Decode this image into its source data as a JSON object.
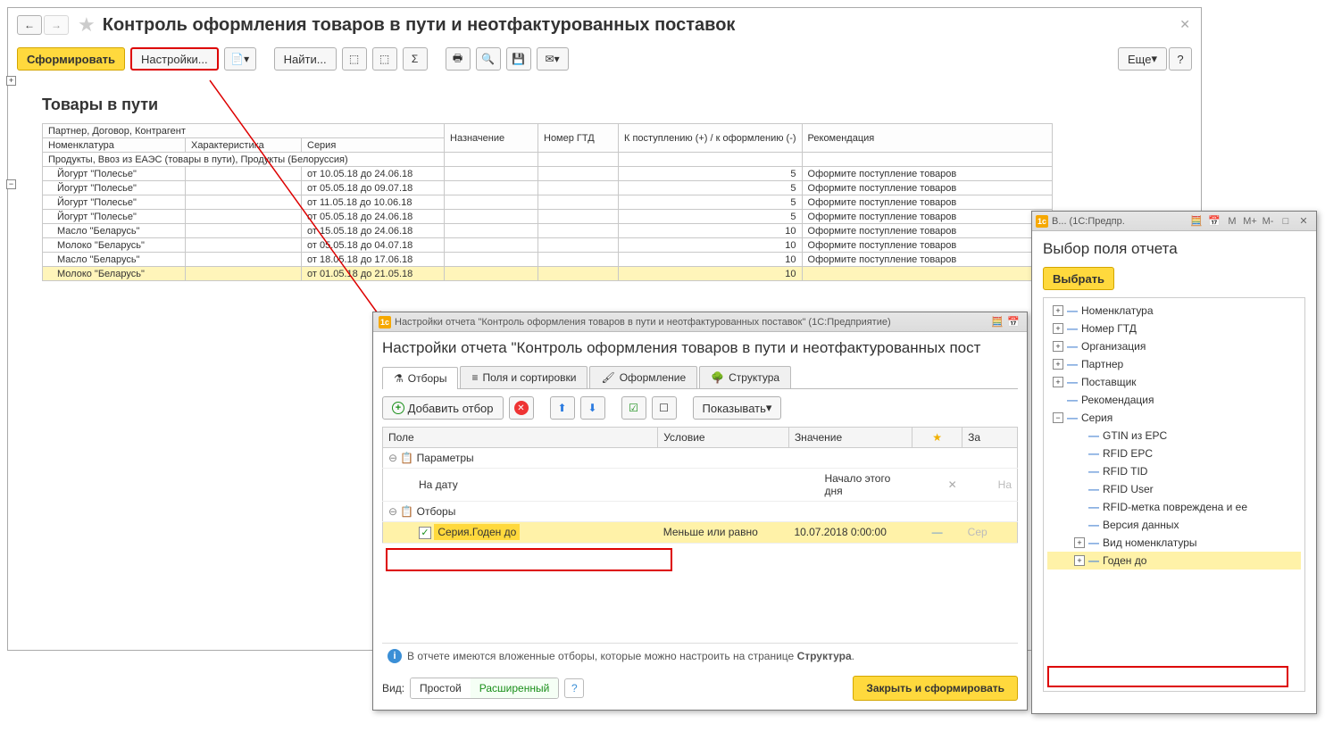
{
  "page_title": "Контроль оформления товаров в пути и неотфактурованных поставок",
  "toolbar": {
    "generate": "Сформировать",
    "settings": "Настройки...",
    "find": "Найти...",
    "more": "Еще",
    "help": "?"
  },
  "report": {
    "title": "Товары в пути",
    "headers": {
      "partner": "Партнер, Договор, Контрагент",
      "nomen": "Номенклатура",
      "char": "Характеристика",
      "series": "Серия",
      "dest": "Назначение",
      "gtd": "Номер ГТД",
      "incoming": "К поступлению (+) / к оформлению (-)",
      "recom": "Рекомендация"
    },
    "group_row": "Продукты, Ввоз из ЕАЭС (товары в пути), Продукты (Белоруссия)",
    "rows": [
      {
        "n": "Йогурт \"Полесье\"",
        "s": "от 10.05.18 до 24.06.18",
        "q": 5,
        "r": "Оформите поступление товаров"
      },
      {
        "n": "Йогурт \"Полесье\"",
        "s": "от 05.05.18 до 09.07.18",
        "q": 5,
        "r": "Оформите поступление товаров"
      },
      {
        "n": "Йогурт \"Полесье\"",
        "s": "от 11.05.18 до 10.06.18",
        "q": 5,
        "r": "Оформите поступление товаров"
      },
      {
        "n": "Йогурт \"Полесье\"",
        "s": "от 05.05.18 до 24.06.18",
        "q": 5,
        "r": "Оформите поступление товаров"
      },
      {
        "n": "Масло \"Беларусь\"",
        "s": "от 15.05.18 до 24.06.18",
        "q": 10,
        "r": "Оформите поступление товаров"
      },
      {
        "n": "Молоко \"Беларусь\"",
        "s": "от 05.05.18 до 04.07.18",
        "q": 10,
        "r": "Оформите поступление товаров"
      },
      {
        "n": "Масло \"Беларусь\"",
        "s": "от 18.05.18 до 17.06.18",
        "q": 10,
        "r": "Оформите поступление товаров"
      },
      {
        "n": "Молоко \"Беларусь\"",
        "s": "от 01.05.18 до 21.05.18",
        "q": 10,
        "r": ""
      }
    ]
  },
  "settings_dlg": {
    "titlebar": "Настройки отчета \"Контроль оформления товаров в пути и неотфактурованных поставок\" (1С:Предприятие)",
    "heading": "Настройки отчета \"Контроль оформления товаров в пути и неотфактурованных пост",
    "tabs": {
      "filters": "Отборы",
      "fields": "Поля и сортировки",
      "design": "Оформление",
      "struct": "Структура"
    },
    "sub": {
      "add": "Добавить отбор",
      "show": "Показывать"
    },
    "th": {
      "field": "Поле",
      "cond": "Условие",
      "value": "Значение",
      "star": "★",
      "title": "За"
    },
    "rows": {
      "params": "Параметры",
      "on_date": "На дату",
      "on_date_val": "Начало этого дня",
      "on_date_title": "На",
      "filters": "Отборы",
      "sel_field": "Серия.Годен до",
      "sel_cond": "Меньше или равно",
      "sel_val": "10.07.2018 0:00:00",
      "sel_title": "Сер"
    },
    "info": "В отчете имеются вложенные отборы, которые можно настроить на странице ",
    "info_b": "Структура",
    "view_label": "Вид:",
    "view_simple": "Простой",
    "view_ext": "Расширенный",
    "close_btn": "Закрыть и сформировать"
  },
  "field_dlg": {
    "titlebar_left": "В... (1С:Предпр.",
    "m": "M",
    "mp": "M+",
    "mm": "M-",
    "heading": "Выбор поля отчета",
    "select": "Выбрать",
    "tree": [
      {
        "lv": 1,
        "exp": "+",
        "label": "Номенклатура"
      },
      {
        "lv": 1,
        "exp": "+",
        "label": "Номер ГТД"
      },
      {
        "lv": 1,
        "exp": "+",
        "label": "Организация"
      },
      {
        "lv": 1,
        "exp": "+",
        "label": "Партнер"
      },
      {
        "lv": 1,
        "exp": "+",
        "label": "Поставщик"
      },
      {
        "lv": 1,
        "exp": "",
        "label": "Рекомендация"
      },
      {
        "lv": 1,
        "exp": "-",
        "label": "Серия"
      },
      {
        "lv": 2,
        "exp": "",
        "label": "GTIN из EPC"
      },
      {
        "lv": 2,
        "exp": "",
        "label": "RFID EPC"
      },
      {
        "lv": 2,
        "exp": "",
        "label": "RFID TID"
      },
      {
        "lv": 2,
        "exp": "",
        "label": "RFID User"
      },
      {
        "lv": 2,
        "exp": "",
        "label": "RFID-метка повреждена и ее"
      },
      {
        "lv": 2,
        "exp": "",
        "label": "Версия данных"
      },
      {
        "lv": 2,
        "exp": "+",
        "label": "Вид номенклатуры"
      },
      {
        "lv": 2,
        "exp": "+",
        "label": "Годен до",
        "sel": true
      }
    ]
  }
}
